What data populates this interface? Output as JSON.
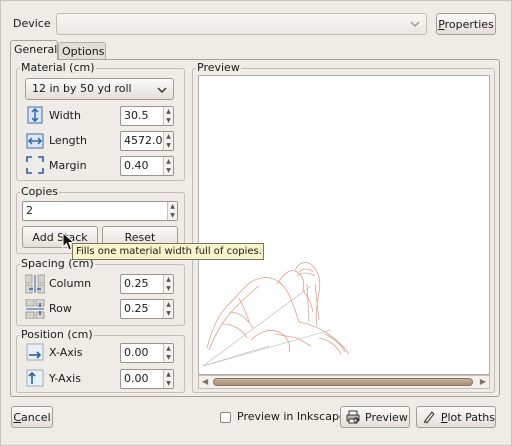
{
  "device": {
    "label": "Device",
    "value": "",
    "properties_button": "Properties"
  },
  "tabs": [
    {
      "label": "General",
      "active": true
    },
    {
      "label": "Options",
      "active": false
    }
  ],
  "material": {
    "title": "Material (cm)",
    "roll_select": "12 in by 50 yd roll",
    "width": {
      "label": "Width",
      "value": "30.5",
      "icon": "width-arrows-icon"
    },
    "length": {
      "label": "Length",
      "value": "4572.0",
      "icon": "length-arrows-icon"
    },
    "margin": {
      "label": "Margin",
      "value": "0.40",
      "icon": "margin-corners-icon"
    }
  },
  "copies": {
    "title": "Copies",
    "value": "2",
    "add_stack_button": "Add Stack",
    "reset_button": "Reset",
    "tooltip": "Fills one material width full of copies."
  },
  "spacing": {
    "title": "Spacing (cm)",
    "column": {
      "label": "Column",
      "value": "0.25",
      "icon": "column-spacing-icon"
    },
    "row": {
      "label": "Row",
      "value": "0.25",
      "icon": "row-spacing-icon"
    }
  },
  "position": {
    "title": "Position (cm)",
    "x_axis": {
      "label": "X-Axis",
      "value": "0.00",
      "icon": "x-axis-icon"
    },
    "y_axis": {
      "label": "Y-Axis",
      "value": "0.00",
      "icon": "y-axis-icon"
    }
  },
  "preview": {
    "title": "Preview",
    "image": "walrus-outline-drawing",
    "stroke_color": "#e0a08c"
  },
  "footer": {
    "cancel_button": "Cancel",
    "preview_in_inkscape_label": "Preview in Inkscape",
    "preview_in_inkscape_checked": false,
    "preview_button": "Preview",
    "plot_paths_button": "Plot Paths"
  }
}
